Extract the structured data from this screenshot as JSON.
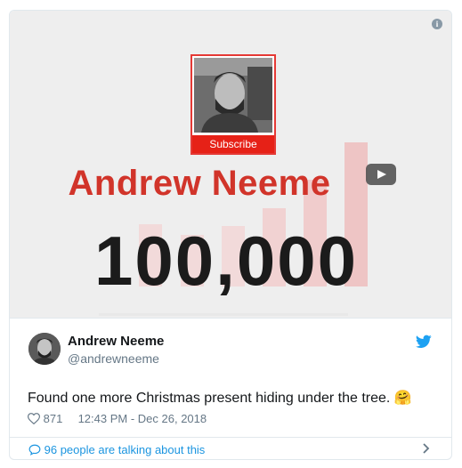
{
  "media": {
    "subscribe_label": "Subscribe",
    "channel_name": "Andrew Neeme",
    "subscriber_count": "100,000"
  },
  "tweet": {
    "author_name": "Andrew Neeme",
    "author_handle": "@andrewneeme",
    "text": "Found one more Christmas present hiding under the tree.",
    "emoji": "🤗",
    "like_count": "871",
    "timestamp": "12:43 PM - Dec 26, 2018"
  },
  "footer": {
    "talk_label": "96 people are talking about this"
  },
  "colors": {
    "accent": "#1b95e0",
    "brand_red": "#d1342a",
    "twitter_blue": "#1da1f2"
  },
  "icons": [
    "info-icon",
    "play-icon",
    "twitter-bird-icon",
    "heart-icon",
    "speech-bubble-icon",
    "chevron-right-icon"
  ]
}
